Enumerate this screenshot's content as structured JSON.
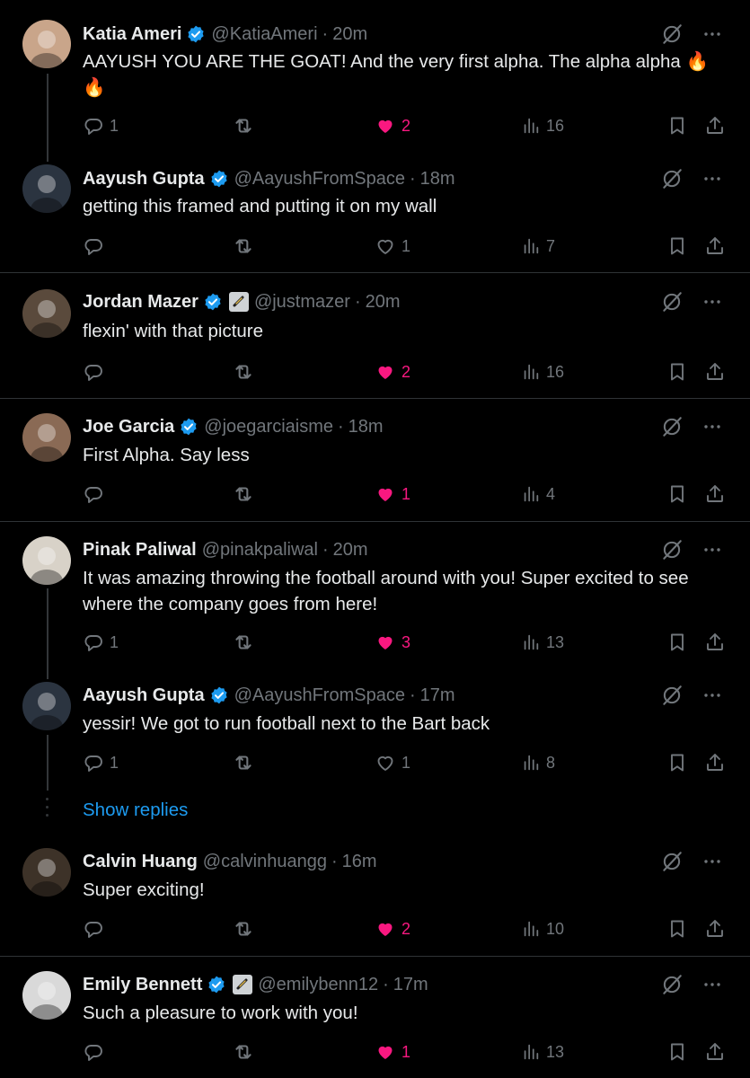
{
  "tweets": [
    {
      "name": "Katia Ameri",
      "verified": true,
      "badge": false,
      "handle": "@KatiaAmeri",
      "time": "20m",
      "text": "AAYUSH YOU ARE THE GOAT! And the very first alpha. The alpha alpha 🔥 🔥",
      "replies": "1",
      "reposts": "",
      "likes": "2",
      "liked": true,
      "views": "16",
      "avatar_color": "#c9a58a"
    },
    {
      "name": "Aayush Gupta",
      "verified": true,
      "badge": false,
      "handle": "@AayushFromSpace",
      "time": "18m",
      "text": "getting this framed and putting it on my wall",
      "replies": "",
      "reposts": "",
      "likes": "1",
      "liked": false,
      "views": "7",
      "avatar_color": "#2b3440"
    },
    {
      "name": "Jordan Mazer",
      "verified": true,
      "badge": true,
      "handle": "@justmazer",
      "time": "20m",
      "text": "flexin' with that picture",
      "replies": "",
      "reposts": "",
      "likes": "2",
      "liked": true,
      "views": "16",
      "avatar_color": "#5a4a3c"
    },
    {
      "name": "Joe Garcia",
      "verified": true,
      "badge": false,
      "handle": "@joegarciaisme",
      "time": "18m",
      "text": "First Alpha. Say less",
      "replies": "",
      "reposts": "",
      "likes": "1",
      "liked": true,
      "views": "4",
      "avatar_color": "#8a6a55"
    },
    {
      "name": "Pinak Paliwal",
      "verified": false,
      "badge": false,
      "handle": "@pinakpaliwal",
      "time": "20m",
      "text": "It was amazing throwing the football around with you! Super excited to see where the company goes from here!",
      "replies": "1",
      "reposts": "",
      "likes": "3",
      "liked": true,
      "views": "13",
      "avatar_color": "#d8d2c8"
    },
    {
      "name": "Aayush Gupta",
      "verified": true,
      "badge": false,
      "handle": "@AayushFromSpace",
      "time": "17m",
      "text": "yessir! We got to run football next to the Bart back",
      "replies": "1",
      "reposts": "",
      "likes": "1",
      "liked": false,
      "views": "8",
      "avatar_color": "#2b3440"
    },
    {
      "name": "Calvin Huang",
      "verified": false,
      "badge": false,
      "handle": "@calvinhuangg",
      "time": "16m",
      "text": "Super exciting!",
      "replies": "",
      "reposts": "",
      "likes": "2",
      "liked": true,
      "views": "10",
      "avatar_color": "#3d3228"
    },
    {
      "name": "Emily Bennett",
      "verified": true,
      "badge": true,
      "handle": "@emilybenn12",
      "time": "17m",
      "text": "Such a pleasure to work with you!",
      "replies": "",
      "reposts": "",
      "likes": "1",
      "liked": true,
      "views": "13",
      "avatar_color": "#d9d9d9"
    }
  ],
  "show_replies_label": "Show replies",
  "separator": "·",
  "colors": {
    "accent": "#1d9bf0",
    "like": "#f91880",
    "muted": "#71767b",
    "text": "#e7e9ea",
    "divider": "#2f3336"
  },
  "icons": {
    "reply": "reply-icon",
    "repost": "repost-icon",
    "like": "heart-icon",
    "views": "views-icon",
    "bookmark": "bookmark-icon",
    "share": "share-icon",
    "grok": "grok-icon",
    "more": "more-icon",
    "verified": "verified-badge-icon"
  }
}
